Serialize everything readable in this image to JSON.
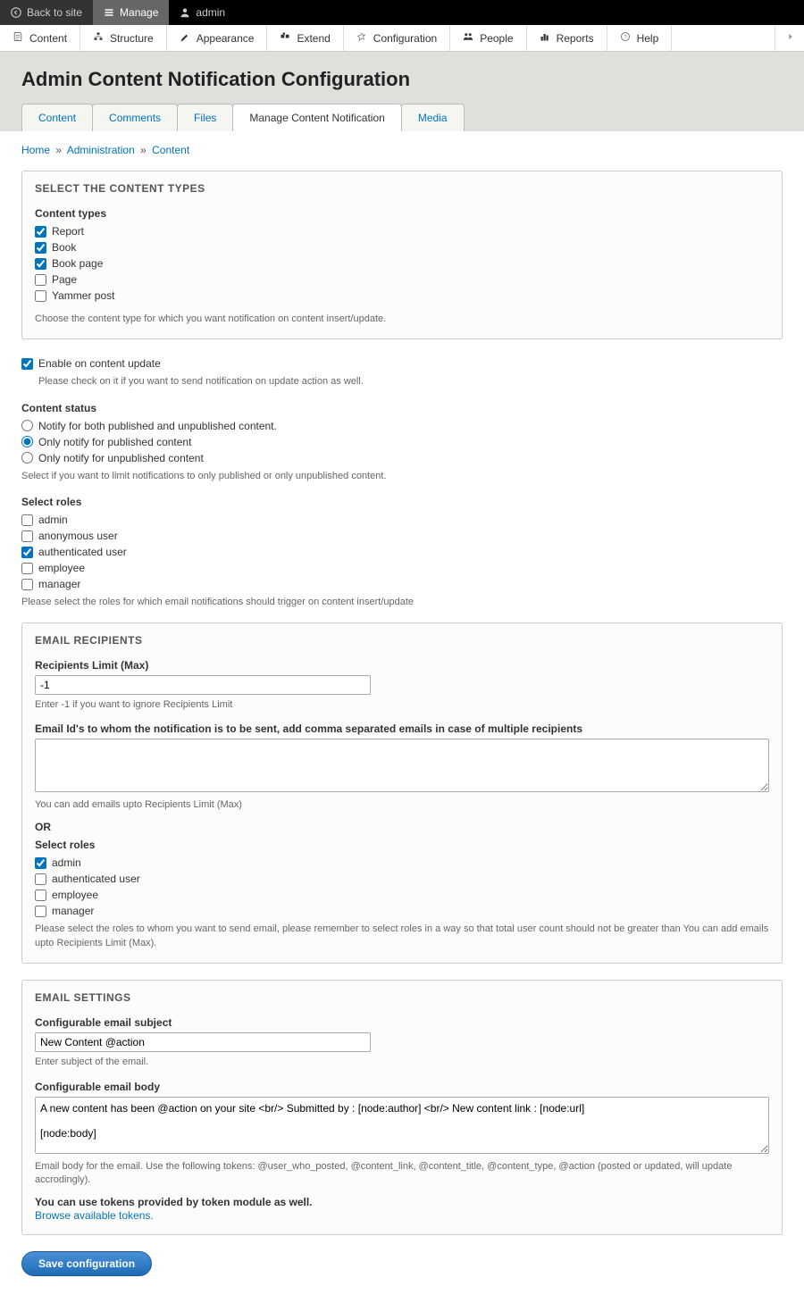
{
  "toolbar": {
    "back": "Back to site",
    "manage": "Manage",
    "user": "admin"
  },
  "admin_menu": {
    "content": "Content",
    "structure": "Structure",
    "appearance": "Appearance",
    "extend": "Extend",
    "configuration": "Configuration",
    "people": "People",
    "reports": "Reports",
    "help": "Help"
  },
  "page_title": "Admin Content Notification Configuration",
  "tabs": {
    "content": "Content",
    "comments": "Comments",
    "files": "Files",
    "manage_notification": "Manage Content Notification",
    "media": "Media"
  },
  "breadcrumb": {
    "home": "Home",
    "administration": "Administration",
    "content": "Content"
  },
  "content_types": {
    "legend": "Select the content types",
    "label": "Content types",
    "options": {
      "report": "Report",
      "book": "Book",
      "book_page": "Book page",
      "page": "Page",
      "yammer": "Yammer post"
    },
    "desc": "Choose the content type for which you want notification on content insert/update."
  },
  "enable_update": {
    "label": "Enable on content update",
    "desc": "Please check on it if you want to send notification on update action as well."
  },
  "content_status": {
    "label": "Content status",
    "both": "Notify for both published and unpublished content.",
    "published": "Only notify for published content",
    "unpublished": "Only notify for unpublished content",
    "desc": "Select if you want to limit notifications to only published or only unpublished content."
  },
  "select_roles": {
    "label": "Select roles",
    "admin": "admin",
    "anonymous": "anonymous user",
    "authenticated": "authenticated user",
    "employee": "employee",
    "manager": "manager",
    "desc": "Please select the roles for which email notifications should trigger on content insert/update"
  },
  "email_recipients": {
    "legend": "Email Recipients",
    "limit_label": "Recipients Limit (Max)",
    "limit_value": "-1",
    "limit_desc": "Enter -1 if you want to ignore Recipients Limit",
    "emails_label": "Email Id's to whom the notification is to be sent, add comma separated emails in case of multiple recipients",
    "emails_value": "",
    "emails_desc": "You can add emails upto Recipients Limit (Max)",
    "or": "OR",
    "roles_label": "Select roles",
    "roles": {
      "admin": "admin",
      "authenticated": "authenticated user",
      "employee": "employee",
      "manager": "manager"
    },
    "roles_desc": "Please select the roles to whom you want to send email, please remember to select roles in a way so that total user count should not be greater than You can add emails upto Recipients Limit (Max)."
  },
  "email_settings": {
    "legend": "Email Settings",
    "subject_label": "Configurable email subject",
    "subject_value": "New Content @action",
    "subject_desc": "Enter subject of the email.",
    "body_label": "Configurable email body",
    "body_value": "A new content has been @action on your site <br/> Submitted by : [node:author] <br/> New content link : [node:url]\n\n[node:body]",
    "body_desc": "Email body for the email. Use the following tokens: @user_who_posted, @content_link, @content_title, @content_type, @action (posted or updated, will update accrodingly).",
    "tokens_note": "You can use tokens provided by token module as well.",
    "tokens_link": "Browse available tokens."
  },
  "save_button": "Save configuration"
}
